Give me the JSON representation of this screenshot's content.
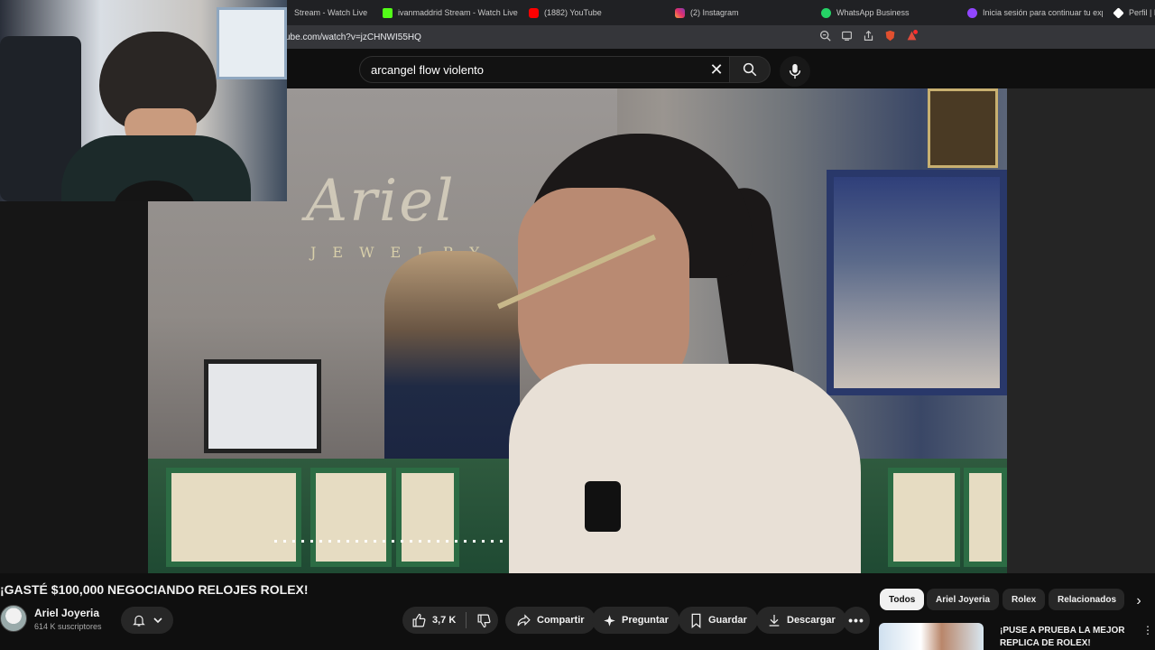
{
  "browser": {
    "tabs": [
      {
        "label": "Stream - Watch Live",
        "icon": "kick-icon",
        "color": "#3c3c3c"
      },
      {
        "label": "ivanmaddrid Stream - Watch Live",
        "icon": "kick-icon",
        "color": "#53fc18"
      },
      {
        "label": "(1882) YouTube",
        "icon": "youtube-icon",
        "color": "#ff0000"
      },
      {
        "label": "(2) Instagram",
        "icon": "instagram-icon",
        "color": "#e1306c"
      },
      {
        "label": "WhatsApp Business",
        "icon": "whatsapp-icon",
        "color": "#25d366"
      },
      {
        "label": "Inicia sesión para continuar tu exp",
        "icon": "twitch-icon",
        "color": "#9146ff"
      },
      {
        "label": "Perfil | E",
        "icon": "diamond-icon",
        "color": "#ffffff"
      }
    ],
    "url": "ube.com/watch?v=jzCHNWI55HQ"
  },
  "header": {
    "search_query": "arcangel flow violento"
  },
  "video": {
    "title": "¡GASTÉ $100,000 NEGOCIANDO RELOJES ROLEX!",
    "logo_text": "Ariel",
    "logo_sub": "JEWELRY",
    "channel": {
      "name": "Ariel Joyeria",
      "subscribers": "614 K suscriptores"
    },
    "actions": {
      "likes": "3,7 K",
      "share": "Compartir",
      "ask": "Preguntar",
      "save": "Guardar",
      "download": "Descargar"
    }
  },
  "sidebar": {
    "chips": [
      "Todos",
      "Ariel Joyeria",
      "Rolex",
      "Relacionados"
    ],
    "recommendation": {
      "title": "¡PUSE A PRUEBA LA MEJOR REPLICA DE ROLEX!"
    }
  }
}
